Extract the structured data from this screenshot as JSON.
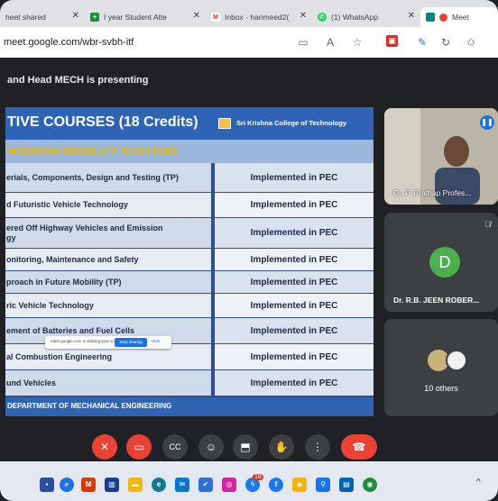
{
  "browser": {
    "tabs": [
      {
        "label": "heet shared",
        "favicon_color": "#f4a300"
      },
      {
        "label": "I year Student Atte",
        "favicon_color": "#1e8e3e",
        "favicon_glyph": "+"
      },
      {
        "label": "Inbox - harimeed2(",
        "favicon_color": "#d93025",
        "favicon_glyph": "M"
      },
      {
        "label": "(1) WhatsApp",
        "favicon_color": "#25d366",
        "favicon_glyph": "✆"
      },
      {
        "label": "Meet",
        "favicon_color": "#00897b"
      }
    ],
    "url": "meet.google.com/wbr-svbh-itf",
    "toolbar_icons": [
      "tab-icon",
      "read-aloud-icon",
      "favorite-star-icon",
      "extension-icon",
      "pen-icon",
      "refresh-icon",
      "favorites-icon"
    ]
  },
  "meet": {
    "presenting_text": "and Head MECH is presenting",
    "slide": {
      "title": "TIVE COURSES (18 Credits)",
      "college": "Sri Krishna College of Technology",
      "subtitle": "MODERN MOBILITY SYSTEMS",
      "rows": [
        {
          "course": "erials, Components, Design and Testing (TP)",
          "status": "Implemented in PEC"
        },
        {
          "course": "d Futuristic Vehicle Technology",
          "status": "Implemented in PEC"
        },
        {
          "course": "ered Off Highway Vehicles and Emission\ngy",
          "status": "Implemented in PEC"
        },
        {
          "course": "onitoring, Maintenance and Safety",
          "status": "Implemented in PEC"
        },
        {
          "course": "proach in Future Mobility (TP)",
          "status": "Implemented in PEC"
        },
        {
          "course": "ric Vehicle Technology",
          "status": "Implemented in PEC"
        },
        {
          "course": "ement of Batteries and Fuel Cells",
          "status": "Implemented in PEC"
        },
        {
          "course": "al Combustion Engineering",
          "status": "Implemented in PEC"
        },
        {
          "course": "und Vehicles",
          "status": "Implemented in PEC"
        }
      ],
      "footer": "DEPARTMENT OF MECHANICAL ENGINEERING"
    },
    "share_banner": {
      "text": "meet.google.com is sharing your screen.",
      "stop": "Stop sharing",
      "hide": "Hide"
    },
    "participants": [
      {
        "name": "Dr. P. Prathap Profes...",
        "kind": "video"
      },
      {
        "name": "Dr. R.B. JEEN ROBER...",
        "initial": "D",
        "kind": "avatar",
        "avatar_color": "#4caf50"
      },
      {
        "name": "10 others",
        "kind": "group"
      }
    ],
    "controls": [
      "mic-off-icon",
      "camera-off-icon",
      "captions-icon",
      "emoji-icon",
      "present-icon",
      "raise-hand-icon",
      "more-options-icon",
      "end-call-icon"
    ]
  },
  "taskbar": {
    "icons": [
      {
        "name": "start-icon",
        "color": "#2b4f9a"
      },
      {
        "name": "search-icon",
        "color": "#1a73e8"
      },
      {
        "name": "office-icon",
        "color": "#d83b01"
      },
      {
        "name": "task-view-icon",
        "color": "#1a3d8f"
      },
      {
        "name": "file-explorer-icon",
        "color": "#f4b400"
      },
      {
        "name": "edge-icon",
        "color": "#0f7b8c"
      },
      {
        "name": "mail-icon",
        "color": "#0078d4"
      },
      {
        "name": "todo-icon",
        "color": "#2f6fdc"
      },
      {
        "name": "instagram-icon",
        "color": "#d6249f"
      },
      {
        "name": "messenger-icon",
        "color": "#1877f2"
      },
      {
        "name": "facebook-icon",
        "color": "#1877f2"
      },
      {
        "name": "maps-icon",
        "color": "#f4b400"
      },
      {
        "name": "network-icon",
        "color": "#1a73e8"
      },
      {
        "name": "store-icon",
        "color": "#0063b1"
      },
      {
        "name": "chrome-icon",
        "color": "#1e8e3e"
      }
    ],
    "badge": "18"
  }
}
